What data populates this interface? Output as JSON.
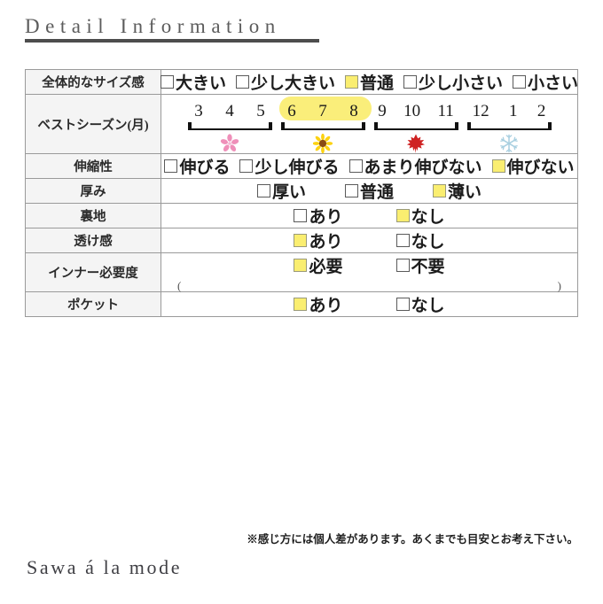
{
  "header": {
    "title": "Detail Information"
  },
  "table": {
    "rows": [
      {
        "label": "全体的なサイズ感",
        "type": "checkbox",
        "spacing": "gap-sm",
        "options": [
          {
            "label": "大きい",
            "checked": false
          },
          {
            "label": "少し大きい",
            "checked": false
          },
          {
            "label": "普通",
            "checked": true
          },
          {
            "label": "少し小さい",
            "checked": false
          },
          {
            "label": "小さい",
            "checked": false
          }
        ]
      },
      {
        "label": "ベストシーズン(月)",
        "type": "season",
        "groups": [
          {
            "name": "spring",
            "months": [
              "3",
              "4",
              "5"
            ],
            "icon": "cherry-blossom-icon",
            "highlighted": false
          },
          {
            "name": "summer",
            "months": [
              "6",
              "7",
              "8"
            ],
            "icon": "sunflower-icon",
            "highlighted": true
          },
          {
            "name": "autumn",
            "months": [
              "9",
              "10",
              "11"
            ],
            "icon": "maple-leaf-icon",
            "highlighted": false
          },
          {
            "name": "winter",
            "months": [
              "12",
              "1",
              "2"
            ],
            "icon": "snowflake-icon",
            "highlighted": false
          }
        ]
      },
      {
        "label": "伸縮性",
        "type": "checkbox",
        "spacing": "gap-sm",
        "options": [
          {
            "label": "伸びる",
            "checked": false
          },
          {
            "label": "少し伸びる",
            "checked": false
          },
          {
            "label": "あまり伸びない",
            "checked": false
          },
          {
            "label": "伸びない",
            "checked": true
          }
        ]
      },
      {
        "label": "厚み",
        "type": "checkbox",
        "spacing": "gap-md",
        "options": [
          {
            "label": "厚い",
            "checked": false
          },
          {
            "label": "普通",
            "checked": false
          },
          {
            "label": "薄い",
            "checked": true
          }
        ]
      },
      {
        "label": "裏地",
        "type": "checkbox",
        "spacing": "gap-lg",
        "options": [
          {
            "label": "あり",
            "checked": false
          },
          {
            "label": "なし",
            "checked": true
          }
        ]
      },
      {
        "label": "透け感",
        "type": "checkbox",
        "spacing": "gap-lg",
        "options": [
          {
            "label": "あり",
            "checked": true
          },
          {
            "label": "なし",
            "checked": false
          }
        ]
      },
      {
        "label": "インナー必要度",
        "type": "checkbox-paren",
        "spacing": "gap-lg",
        "options": [
          {
            "label": "必要",
            "checked": true
          },
          {
            "label": "不要",
            "checked": false
          }
        ],
        "paren_left": "(",
        "paren_right": ")"
      },
      {
        "label": "ポケット",
        "type": "checkbox",
        "spacing": "gap-lg",
        "options": [
          {
            "label": "あり",
            "checked": true
          },
          {
            "label": "なし",
            "checked": false
          }
        ]
      }
    ]
  },
  "footnote": "※感じ方には個人差があります。あくまでも目安とお考え下さい。",
  "brand": "Sawa á la mode",
  "colors": {
    "checked_yellow": "#faee70",
    "season_pill": "#faee7a",
    "label_bg": "#f4f4f4",
    "border": "#9a9a9a",
    "title_rule": "#4d4d4d"
  }
}
